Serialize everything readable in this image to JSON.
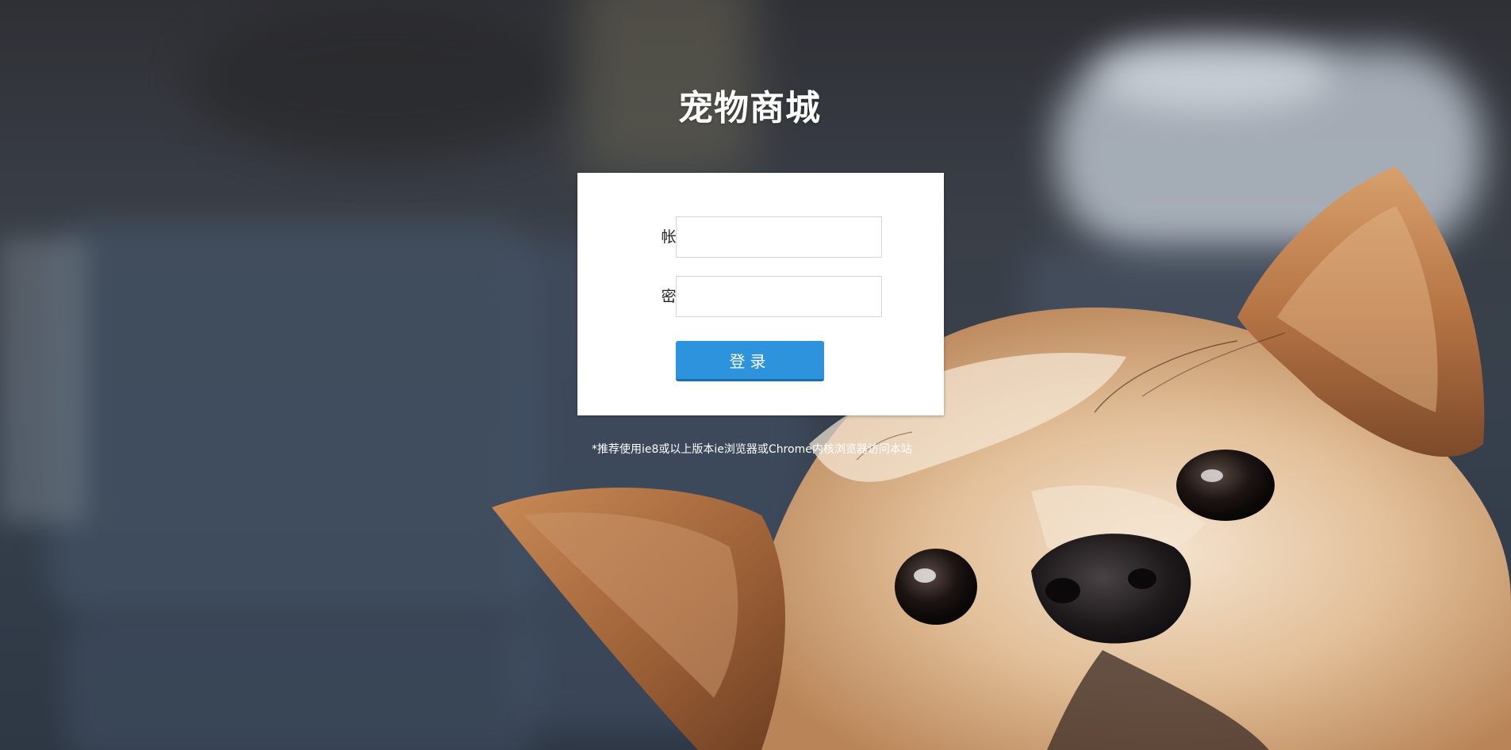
{
  "app": {
    "title": "宠物商城"
  },
  "login_form": {
    "username_label": "帐号:",
    "username_value": "",
    "password_label": "密码:",
    "password_value": "",
    "submit_label": "登录"
  },
  "footer": {
    "browser_tip": "*推荐使用ie8或以上版本ie浏览器或Chrome内核浏览器访问本站"
  },
  "colors": {
    "button": "#2d93dd",
    "panel": "#ffffff",
    "title": "#ffffff"
  },
  "background": {
    "image_subject": "blurred-room-with-small-dog"
  }
}
